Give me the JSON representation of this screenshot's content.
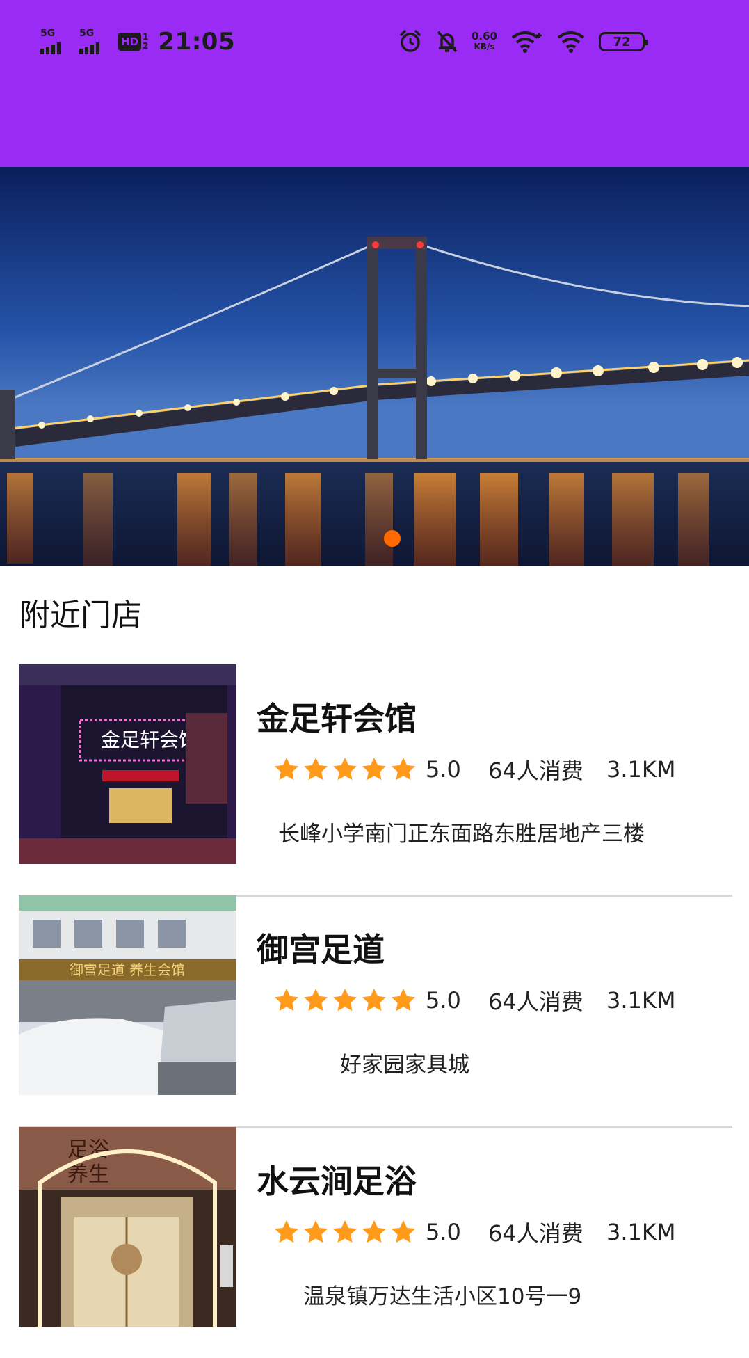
{
  "status_bar": {
    "network_1": "5G",
    "network_2": "5G",
    "hd_label": "HD",
    "hd_sup": "1",
    "hd_sub": "2",
    "time": "21:05",
    "speed_value": "0.60",
    "speed_unit": "KB/s",
    "battery": "72"
  },
  "colors": {
    "header_bg": "#9a2bf5",
    "star": "#ff9a1a",
    "indicator": "#ff6a00"
  },
  "banner": {
    "image": "night-bridge-photo",
    "page_indicator": {
      "current": 1,
      "total": 1
    }
  },
  "section": {
    "title": "附近门店"
  },
  "stores": [
    {
      "name": "金足轩会馆",
      "stars": 5,
      "rating": "5.0",
      "consumers": "64人消费",
      "distance": "3.1KM",
      "address": "长峰小学南门正东面路东胜居地产三楼"
    },
    {
      "name": "御宫足道",
      "stars": 5,
      "rating": "5.0",
      "consumers": "64人消费",
      "distance": "3.1KM",
      "address": "好家园家具城"
    },
    {
      "name": "水云涧足浴",
      "stars": 5,
      "rating": "5.0",
      "consumers": "64人消费",
      "distance": "3.1KM",
      "address": "温泉镇万达生活小区10号一9"
    }
  ]
}
